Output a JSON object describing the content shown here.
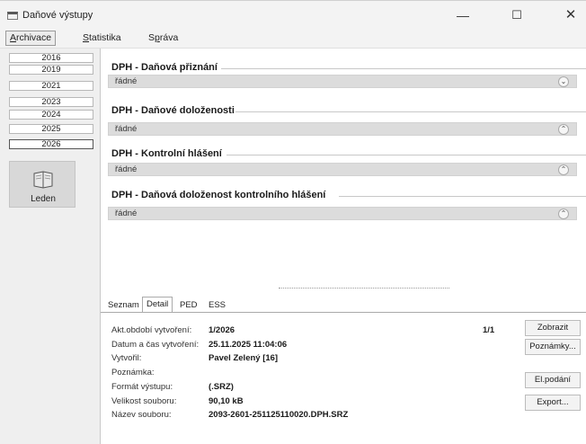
{
  "window": {
    "title": "Daňové výstupy",
    "minimize_glyph": "—",
    "maximize_glyph": "☐",
    "close_glyph": "✕"
  },
  "menu": {
    "archivace": {
      "first": "A",
      "rest": "rchivace"
    },
    "statistika": {
      "first": "S",
      "rest": "tatistika"
    },
    "sprava": {
      "pre": "S",
      "u": "p",
      "rest": "ráva"
    }
  },
  "years": [
    "2016",
    "2019",
    "2021",
    "2023",
    "2024",
    "2025",
    "2026"
  ],
  "month": {
    "label": "Leden",
    "icon": "book-icon"
  },
  "sections": [
    {
      "title": "DPH - Daňová přiznání",
      "value": "řádné",
      "chevron": "⌄"
    },
    {
      "title": "DPH - Daňové doloženosti",
      "value": "řádné",
      "chevron": "⌃"
    },
    {
      "title": "DPH - Kontrolní hlášení",
      "value": "řádné",
      "chevron": "⌃"
    },
    {
      "title": "DPH - Daňová doloženost kontrolního hlášení",
      "value": "řádné",
      "chevron": "⌃"
    }
  ],
  "tabs": [
    "Seznam",
    "Detail",
    "PED",
    "ESS"
  ],
  "active_tab": "Detail",
  "detail": {
    "obdobi_label": "Akt.období vytvoření:",
    "obdobi": "1/2026",
    "datum_label": "Datum a čas vytvoření:",
    "datum": "25.11.2025 11:04:06",
    "vytvoril_label": "Vytvořil:",
    "vytvoril": "Pavel Zelený [16]",
    "poznamka_label": "Poznámka:",
    "format_label": "Formát výstupu:",
    "format": "(.SRZ)",
    "velikost_label": "Velikost souboru:",
    "velikost": "90,10 kB",
    "nazev_label": "Název souboru:",
    "nazev": "2093-2601-251125110020.DPH.SRZ",
    "pager": "1/1"
  },
  "buttons": {
    "zobrazit": "Zobrazit",
    "poznamky": "Poznámky...",
    "elpodani": "El.podání",
    "export": "Export..."
  }
}
